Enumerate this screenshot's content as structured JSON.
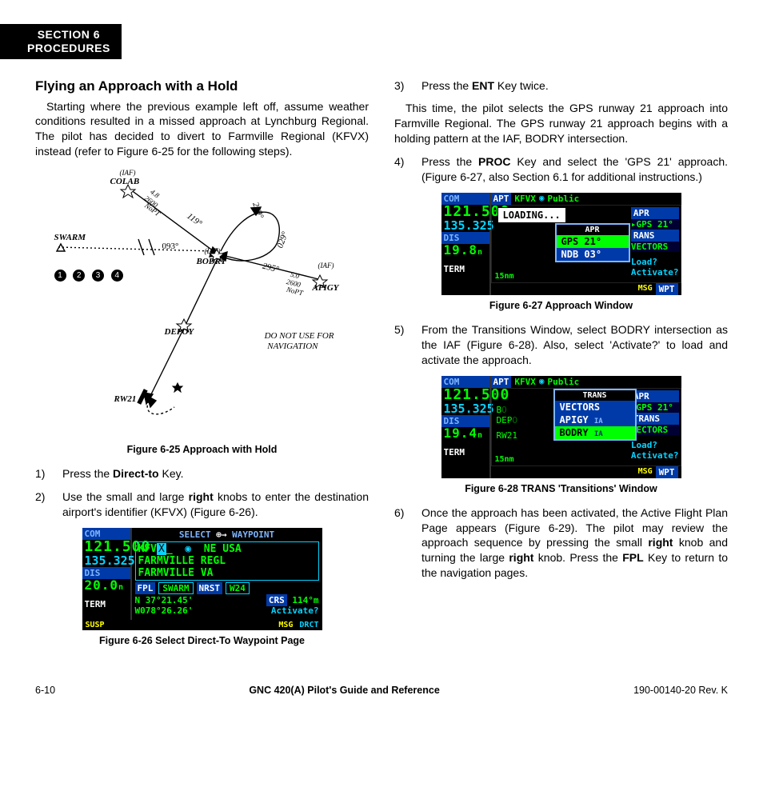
{
  "sectionTab": {
    "line1": "SECTION 6",
    "line2": "PROCEDURES"
  },
  "left": {
    "heading": "Flying an Approach with a Hold",
    "intro": "Starting where the previous example left off, assume weather conditions resulted in a missed approach at Lynchburg Regional.  The pilot has decided to divert to Farmville Regional (KFVX) instead (refer to Figure 6-25 for the following steps).",
    "fig625": {
      "caption": "Figure 6-25  Approach with Hold",
      "colab": "COLAB",
      "iaf": "(IAF)",
      "swarm": "SWARM",
      "bodry": "BODRY",
      "depoy": "DEPOY",
      "rw21": "RW21",
      "apigy": "APIGY",
      "h093": "093°",
      "h119": "119°",
      "h209": "209°",
      "h295": "295°",
      "h029": "029°",
      "leg1": "4.8",
      "leg1b": "2600",
      "leg1c": "NoPT",
      "leg2": "5.0",
      "leg2b": "2600",
      "leg2c": "NoPT",
      "donotuse": "DO NOT USE FOR",
      "donotuse2": "NAVIGATION"
    },
    "steps": [
      {
        "n": "1)",
        "pre": "Press the ",
        "b": "Direct-to",
        "post": " Key."
      },
      {
        "n": "2)",
        "pre": "Use the small and large ",
        "b": "right",
        "post": " knobs to enter the destination airport's identifier (KFVX) (Figure 6-26)."
      }
    ],
    "fig626": {
      "caption": "Figure 6-26  Select Direct-To Waypoint Page",
      "com": "COM",
      "com1": "121.500",
      "com2": "135.325",
      "dis": "DIS",
      "disv": "20.0",
      "dису": "n m",
      "term": "TERM",
      "susp": "SUSP",
      "msg": "MSG",
      "drct": "DRCT",
      "title": "SELECT      WAYPOINT",
      "id": "KFV",
      "idX": "X",
      "region": "NE USA",
      "name1": "FARMVILLE REGL",
      "name2": "FARMVILLE VA",
      "fpl": "FPL",
      "swarm": "SWARM",
      "nrst": "NRST",
      "w24": "W24",
      "lat": "N  37°21.45'",
      "lon": "W078°26.26'",
      "crs": "CRS",
      "crsv": "114°m",
      "activate": "Activate?"
    }
  },
  "right": {
    "step3": {
      "n": "3)",
      "pre": "Press the ",
      "b": "ENT",
      "post": " Key twice."
    },
    "para": "This time, the pilot selects the GPS runway 21 approach into Farmville Regional.  The GPS runway 21 approach begins with a holding pattern at the IAF, BODRY intersection.",
    "step4": {
      "n": "4)",
      "pre": "Press the ",
      "b": "PROC",
      "post": " Key and select the 'GPS 21' approach.  (Figure 6-27, also Section 6.1 for additional instructions.)"
    },
    "fig627": {
      "caption": "Figure 6-27  Approach Window",
      "com": "COM",
      "com1": "121.500",
      "com2": "135.325",
      "dis": "DIS",
      "disv": "19.8",
      "term": "TERM",
      "apt": "APT",
      "kfvx": "KFVX",
      "pub": "Public",
      "loading": "LOADING...",
      "aprHead": "APR",
      "gps21": "GPS 21°",
      "ndb03": "NDB 03°",
      "apr": "APR",
      "gps21b": "GPS 21°",
      "rans": "RANS",
      "vectors": "VECTORS",
      "load": "Load?",
      "activate": "Activate?",
      "msg": "MSG",
      "wpt": "WPT",
      "scale": "15nm"
    },
    "step5": {
      "n": "5)",
      "txt": "From the Transitions Window, select BODRY intersection as the IAF (Figure 6-28).  Also, select 'Activate?' to load and activate the approach."
    },
    "fig628": {
      "caption": "Figure 6-28  TRANS 'Transitions' Window",
      "com": "COM",
      "com1": "121.500",
      "com2": "135.325",
      "dis": "DIS",
      "disv": "19.4",
      "term": "TERM",
      "apt": "APT",
      "kfvx": "KFVX",
      "pub": "Public",
      "transHead": "TRANS",
      "vectors": "VECTORS",
      "apigy": "APIGY",
      "bodry": "BODRY",
      "ia": "IA",
      "bo": "B",
      "depo": "DEP",
      "rw21": "RW21",
      "apr": "APR",
      "gps21": "GPS 21°",
      "trans": "TRANS",
      "vectors2": "VECTORS",
      "load": "Load?",
      "activate": "Activate?",
      "msg": "MSG",
      "wpt": "WPT",
      "scale": "15nm"
    },
    "step6": {
      "n": "6)",
      "p1": "Once the approach has been activated, the Active Flight Plan Page appears (Figure 6-29).  The pilot may review the approach sequence by pressing the small ",
      "b1": "right",
      "p2": " knob and turning the large ",
      "b2": "right",
      "p3": " knob.  Press the ",
      "b3": "FPL",
      "p4": " Key to return to the navigation pages."
    }
  },
  "footer": {
    "left": "6-10",
    "mid": "GNC 420(A) Pilot's Guide and Reference",
    "right": "190-00140-20  Rev. K"
  }
}
